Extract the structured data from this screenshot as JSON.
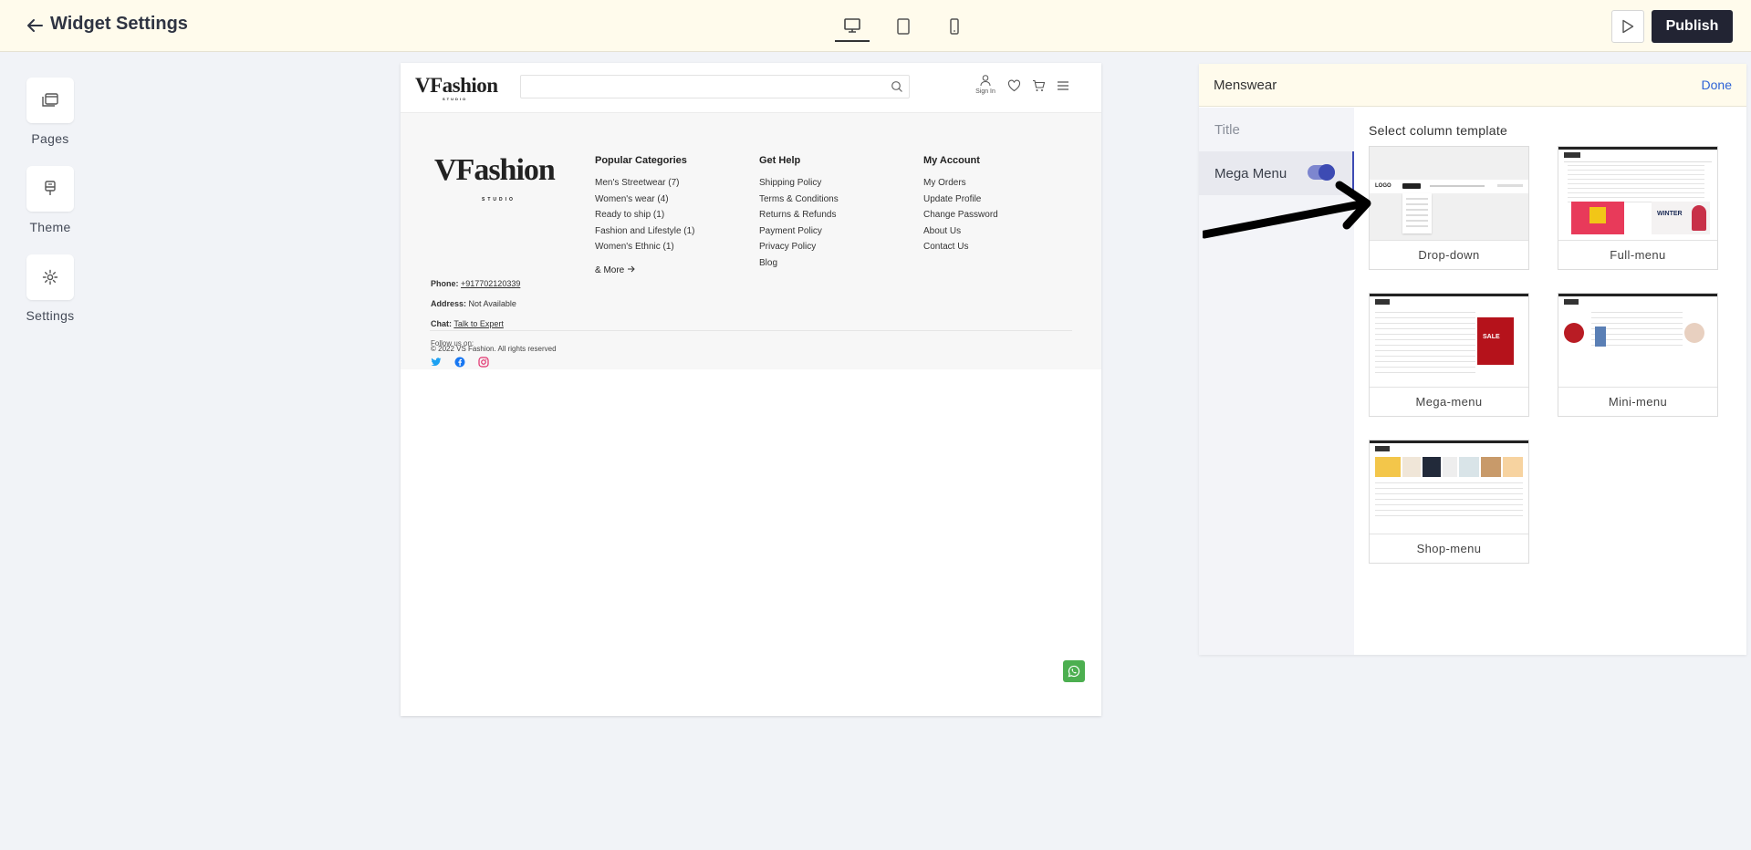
{
  "topbar": {
    "title": "Widget Settings",
    "publish_label": "Publish",
    "devices": [
      "desktop-icon",
      "tablet-icon",
      "mobile-icon"
    ],
    "active_device": "desktop"
  },
  "rail": {
    "items": [
      {
        "label": "Pages",
        "icon": "pages-icon"
      },
      {
        "label": "Theme",
        "icon": "theme-icon"
      },
      {
        "label": "Settings",
        "icon": "gear-icon"
      }
    ]
  },
  "preview": {
    "header": {
      "logo": "VFashion",
      "logo_sub": "STUDIO",
      "signin_label": "Sign In"
    },
    "footer": {
      "logo": "VFashion",
      "logo_sub": "STUDIO",
      "phone_label": "Phone:",
      "phone_value": "+917702120339",
      "address_label": "Address:",
      "address_value": "Not Available",
      "chat_label": "Chat:",
      "chat_value": "Talk to Expert",
      "follow_label": "Follow us on:",
      "columns": [
        {
          "heading": "Popular Categories",
          "links": [
            "Men's Streetwear (7)",
            "Women's wear (4)",
            "Ready to ship (1)",
            "Fashion and Lifestyle (1)",
            "Women's Ethnic (1)"
          ],
          "more": "& More"
        },
        {
          "heading": "Get Help",
          "links": [
            "Shipping Policy",
            "Terms & Conditions",
            "Returns & Refunds",
            "Payment Policy",
            "Privacy Policy",
            "Blog"
          ]
        },
        {
          "heading": "My Account",
          "links": [
            "My Orders",
            "Update Profile",
            "Change Password",
            "About Us",
            "Contact Us"
          ]
        }
      ],
      "copyright": "© 2022 VS Fashion. All rights reserved"
    }
  },
  "panel": {
    "title": "Menswear",
    "done_label": "Done",
    "tabs": [
      {
        "label": "Title"
      },
      {
        "label": "Mega Menu",
        "enabled": true
      }
    ],
    "template_heading": "Select column template",
    "templates": [
      {
        "name": "Drop-down",
        "thumb_logo": "LOGO"
      },
      {
        "name": "Full-menu"
      },
      {
        "name": "Mega-menu"
      },
      {
        "name": "Mini-menu"
      },
      {
        "name": "Shop-menu"
      }
    ]
  },
  "colors": {
    "topbar_bg": "#fffbec",
    "publish_bg": "#222433",
    "accent": "#3d4bb3",
    "link": "#2e63d6",
    "whatsapp": "#4caf50"
  }
}
